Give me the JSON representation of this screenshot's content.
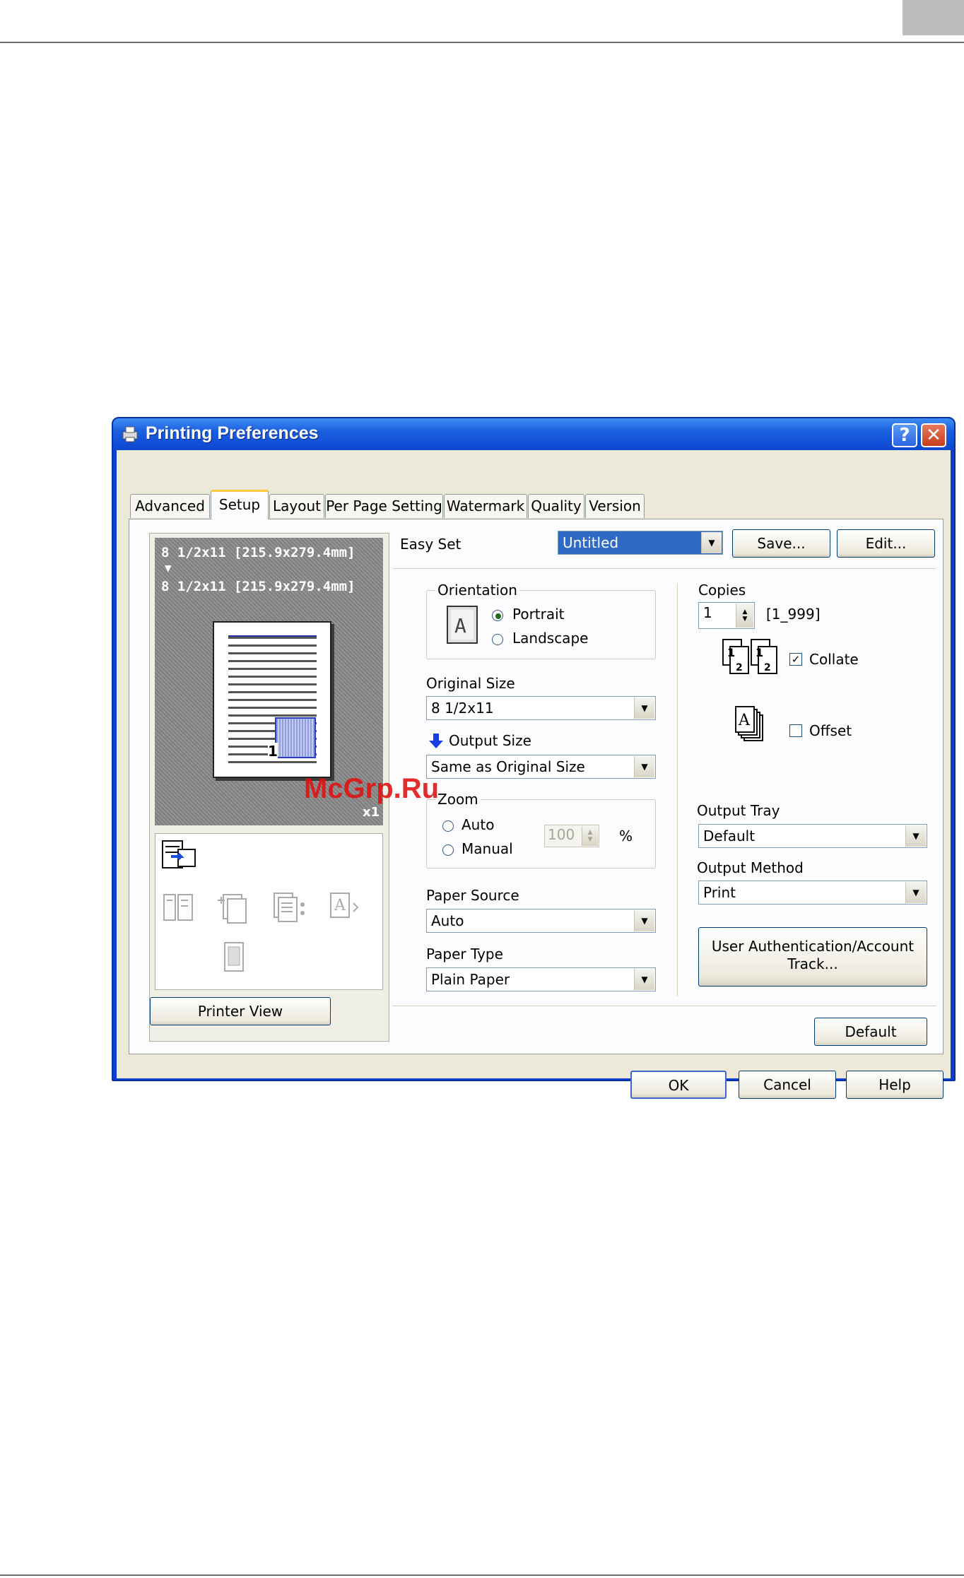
{
  "window": {
    "title": "Printing Preferences",
    "help_button": "?",
    "close_button": "✕"
  },
  "tabs": [
    {
      "label": "Advanced"
    },
    {
      "label": "Setup"
    },
    {
      "label": "Layout"
    },
    {
      "label": "Per Page Setting"
    },
    {
      "label": "Watermark"
    },
    {
      "label": "Quality"
    },
    {
      "label": "Version"
    }
  ],
  "preview": {
    "line1": "8 1/2x11 [215.9x279.4mm]",
    "arrow": "▼",
    "line2": "8 1/2x11 [215.9x279.4mm]",
    "copies_badge": "x1",
    "page_number": "1",
    "printer_view_button": "Printer View"
  },
  "easy_set": {
    "label": "Easy Set",
    "value": "Untitled",
    "save_button": "Save...",
    "edit_button": "Edit..."
  },
  "orientation": {
    "group_label": "Orientation",
    "icon_letter": "A",
    "options": [
      {
        "label": "Portrait",
        "selected": true
      },
      {
        "label": "Landscape",
        "selected": false
      }
    ]
  },
  "original_size": {
    "label": "Original Size",
    "value": "8 1/2x11"
  },
  "output_size": {
    "label": "Output Size",
    "value": "Same as Original Size"
  },
  "zoom": {
    "group_label": "Zoom",
    "auto_label": "Auto",
    "manual_label": "Manual",
    "value": "100",
    "unit": "%"
  },
  "paper_source": {
    "label": "Paper Source",
    "value": "Auto"
  },
  "paper_type": {
    "label": "Paper Type",
    "value": "Plain Paper"
  },
  "copies": {
    "label": "Copies",
    "value": "1",
    "range": "[1_999]",
    "collate_label": "Collate",
    "collate_checked": true,
    "offset_label": "Offset",
    "offset_checked": false,
    "check_mark": "✓"
  },
  "output_tray": {
    "label": "Output Tray",
    "value": "Default"
  },
  "output_method": {
    "label": "Output Method",
    "value": "Print"
  },
  "user_auth_button": {
    "line1": "User Authentication/Account",
    "line2": "Track..."
  },
  "default_button": "Default",
  "footer_buttons": {
    "ok": "OK",
    "cancel": "Cancel",
    "help": "Help"
  },
  "watermark_text": "McGrp.Ru",
  "colors": {
    "titlebar": "#0c47d0",
    "face": "#ece9d8",
    "tab_highlight": "#ffc83c",
    "selection": "#316ac5"
  }
}
